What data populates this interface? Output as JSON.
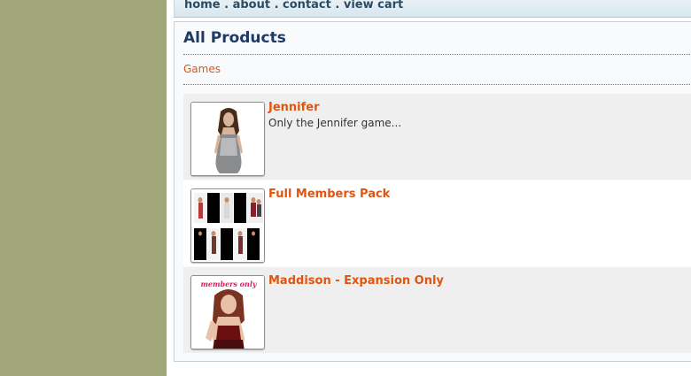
{
  "nav": {
    "links": [
      "home",
      "about",
      "contact",
      "view cart"
    ],
    "separator": " . "
  },
  "page": {
    "title": "All Products",
    "category": "Games"
  },
  "products": [
    {
      "name": "Jennifer",
      "description": "Only the Jennifer game...",
      "image": "character-portrait-icon"
    },
    {
      "name": "Full Members Pack",
      "description": "",
      "image": "character-collage-icon"
    },
    {
      "name": "Maddison - Expansion Only",
      "description": "",
      "image": "members-only-portrait-icon",
      "image_caption": "members only"
    }
  ],
  "colors": {
    "sidebar": "#a0a67a",
    "link_orange": "#e0550f",
    "title_blue": "#1f3a66",
    "row_alt": "#efefef"
  }
}
